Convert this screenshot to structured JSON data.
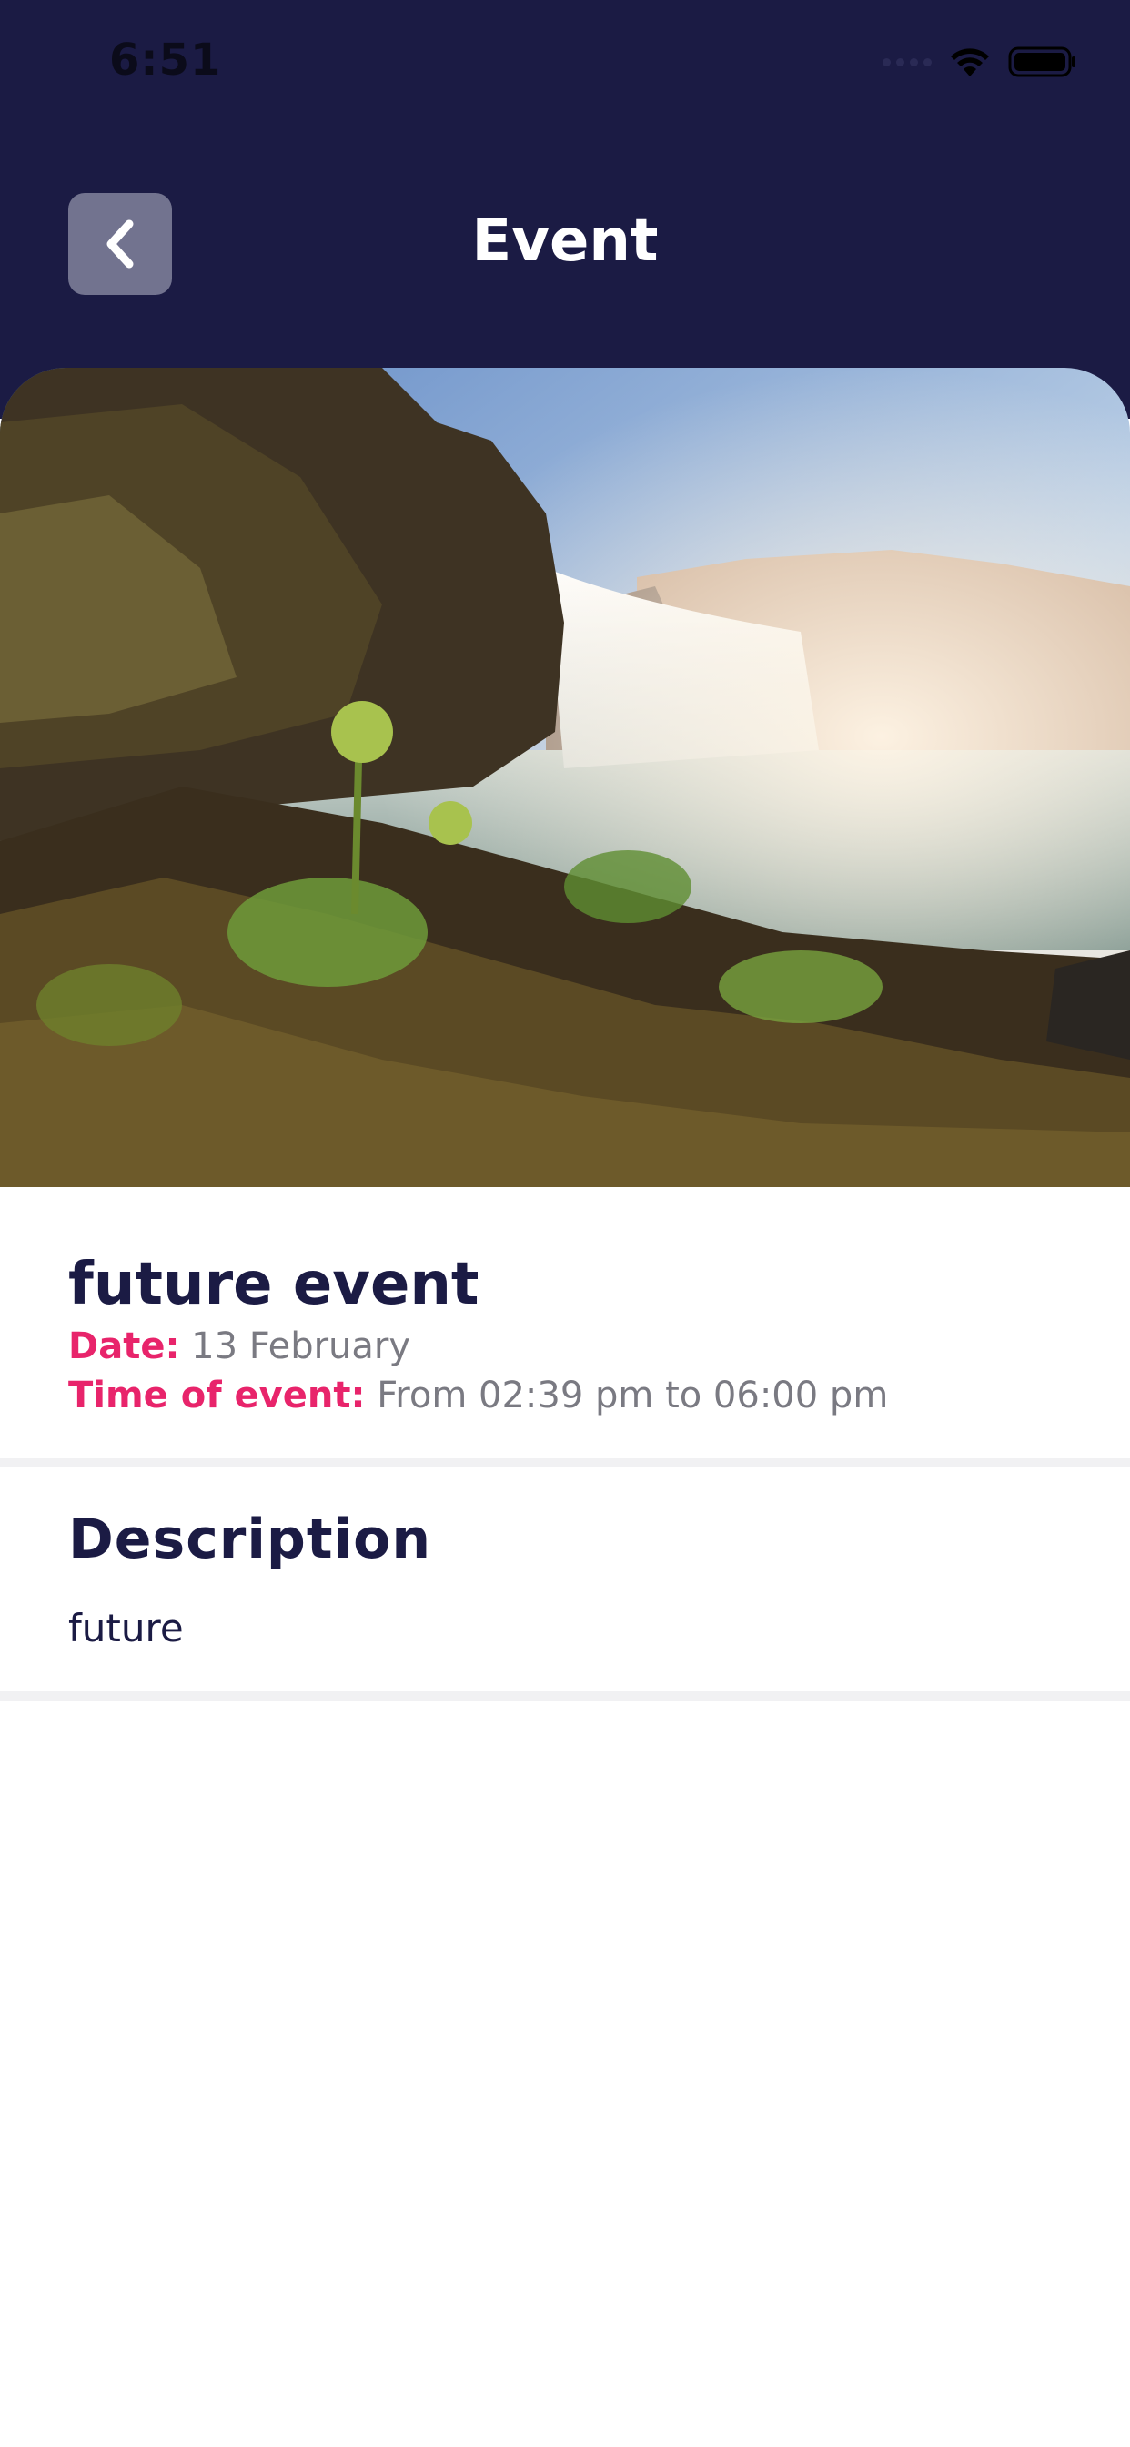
{
  "status_bar": {
    "time": "6:51"
  },
  "header": {
    "title": "Event",
    "back_icon": "chevron-left-icon"
  },
  "hero": {
    "image": "waterfall landscape photo"
  },
  "event": {
    "title": "future event",
    "date_label": "Date:",
    "date_value": "13 February",
    "time_label": "Time of event:",
    "time_value": "From 02:39 pm to 06:00 pm"
  },
  "description": {
    "heading": "Description",
    "text": "future"
  },
  "colors": {
    "navy": "#1b1b44",
    "accent": "#e8246b",
    "muted": "#7a7a82",
    "back_button": "#72738f"
  }
}
